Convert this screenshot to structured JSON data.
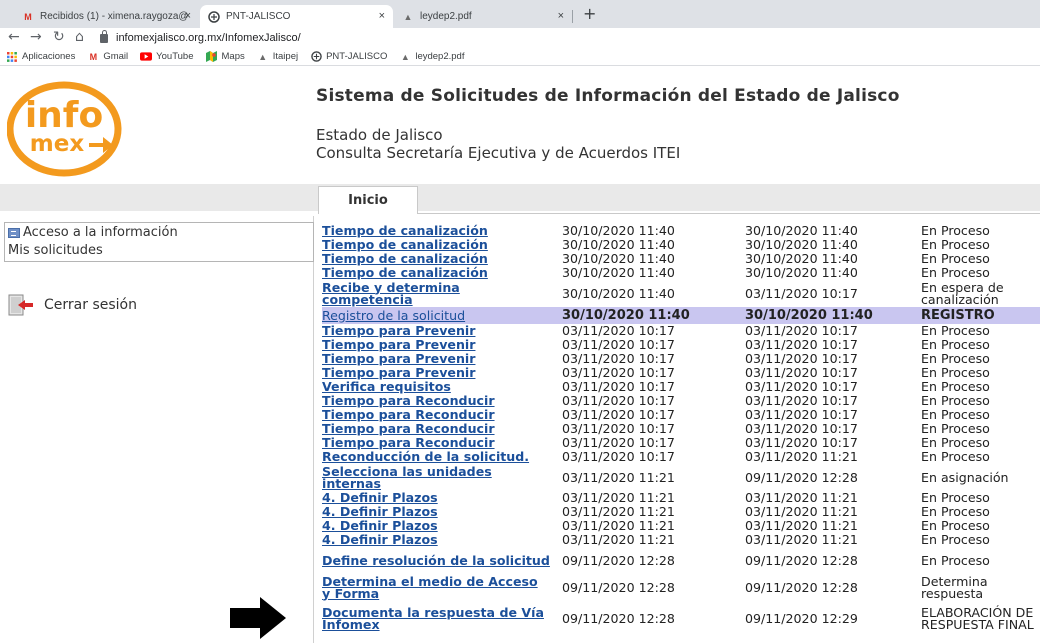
{
  "browser": {
    "tabs": [
      {
        "label": "Recibidos (1) - ximena.raygoza@",
        "icon": "gmail-icon",
        "active": false
      },
      {
        "label": "PNT-JALISCO",
        "icon": "pnt-icon",
        "active": true
      },
      {
        "label": "leydep2.pdf",
        "icon": "itaipej-icon",
        "active": false
      }
    ],
    "new_tab": "+",
    "close_glyph": "×",
    "url": "infomexjalisco.org.mx/InfomexJalisco/",
    "bookmarks": [
      {
        "label": "Aplicaciones",
        "icon": "apps-grid-icon"
      },
      {
        "label": "Gmail",
        "icon": "gmail-icon"
      },
      {
        "label": "YouTube",
        "icon": "youtube-icon"
      },
      {
        "label": "Maps",
        "icon": "maps-icon"
      },
      {
        "label": "Itaipej",
        "icon": "itaipej-icon"
      },
      {
        "label": "PNT-JALISCO",
        "icon": "pnt-icon"
      },
      {
        "label": "leydep2.pdf",
        "icon": "itaipej-icon"
      }
    ]
  },
  "header": {
    "logo_top": "info",
    "logo_bottom": "mex",
    "title": "Sistema de Solicitudes de Información del Estado de Jalisco",
    "state": "Estado de Jalisco",
    "office": "Consulta Secretaría Ejecutiva y de Acuerdos ITEI"
  },
  "nav": {
    "tab_inicio": "Inicio"
  },
  "sidebar": {
    "menu": [
      "Acceso a la información",
      "Mis solicitudes"
    ],
    "logout": "Cerrar sesión"
  },
  "colors": {
    "link": "#1b4f9a",
    "highlight_row": "#c9c6f0",
    "logo_orange": "#f39a1e"
  },
  "table": {
    "rows": [
      {
        "task": "Tiempo de canalización",
        "start": "30/10/2020 11:40",
        "end": "30/10/2020 11:40",
        "status": "En Proceso"
      },
      {
        "task": "Tiempo de canalización",
        "start": "30/10/2020 11:40",
        "end": "30/10/2020 11:40",
        "status": "En Proceso"
      },
      {
        "task": "Tiempo de canalización",
        "start": "30/10/2020 11:40",
        "end": "30/10/2020 11:40",
        "status": "En Proceso"
      },
      {
        "task": "Tiempo de canalización",
        "start": "30/10/2020 11:40",
        "end": "30/10/2020 11:40",
        "status": "En Proceso"
      },
      {
        "task": "Recibe y determina competencia",
        "start": "30/10/2020 11:40",
        "end": "03/11/2020 10:17",
        "status": "En espera de canalización"
      },
      {
        "task": "Registro de la solicitud",
        "start": "30/10/2020 11:40",
        "end": "30/10/2020 11:40",
        "status": "REGISTRO"
      },
      {
        "task": "Tiempo para Prevenir",
        "start": "03/11/2020 10:17",
        "end": "03/11/2020 10:17",
        "status": "En Proceso"
      },
      {
        "task": "Tiempo para Prevenir",
        "start": "03/11/2020 10:17",
        "end": "03/11/2020 10:17",
        "status": "En Proceso"
      },
      {
        "task": "Tiempo para Prevenir",
        "start": "03/11/2020 10:17",
        "end": "03/11/2020 10:17",
        "status": "En Proceso"
      },
      {
        "task": "Tiempo para Prevenir",
        "start": "03/11/2020 10:17",
        "end": "03/11/2020 10:17",
        "status": "En Proceso"
      },
      {
        "task": "Verifica requisitos",
        "start": "03/11/2020 10:17",
        "end": "03/11/2020 10:17",
        "status": "En Proceso"
      },
      {
        "task": "Tiempo para Reconducir",
        "start": "03/11/2020 10:17",
        "end": "03/11/2020 10:17",
        "status": "En Proceso"
      },
      {
        "task": "Tiempo para Reconducir",
        "start": "03/11/2020 10:17",
        "end": "03/11/2020 10:17",
        "status": "En Proceso"
      },
      {
        "task": "Tiempo para Reconducir",
        "start": "03/11/2020 10:17",
        "end": "03/11/2020 10:17",
        "status": "En Proceso"
      },
      {
        "task": "Tiempo para Reconducir",
        "start": "03/11/2020 10:17",
        "end": "03/11/2020 10:17",
        "status": "En Proceso"
      },
      {
        "task": "Reconducción de la solicitud.",
        "start": "03/11/2020 10:17",
        "end": "03/11/2020 11:21",
        "status": "En Proceso"
      },
      {
        "task": "Selecciona las unidades internas",
        "start": "03/11/2020 11:21",
        "end": "09/11/2020 12:28",
        "status": "En asignación"
      },
      {
        "task": "4. Definir Plazos",
        "start": "03/11/2020 11:21",
        "end": "03/11/2020 11:21",
        "status": "En Proceso"
      },
      {
        "task": "4. Definir Plazos",
        "start": "03/11/2020 11:21",
        "end": "03/11/2020 11:21",
        "status": "En Proceso"
      },
      {
        "task": "4. Definir Plazos",
        "start": "03/11/2020 11:21",
        "end": "03/11/2020 11:21",
        "status": "En Proceso"
      },
      {
        "task": "4. Definir Plazos",
        "start": "03/11/2020 11:21",
        "end": "03/11/2020 11:21",
        "status": "En Proceso"
      },
      {
        "task": "Define resolución de la solicitud",
        "start": "09/11/2020 12:28",
        "end": "09/11/2020 12:28",
        "status": "En Proceso"
      },
      {
        "task": "Determina el medio de Acceso y Forma",
        "start": "09/11/2020 12:28",
        "end": "09/11/2020 12:28",
        "status": "Determina respuesta"
      },
      {
        "task": "Documenta la respuesta de Vía Infomex",
        "start": "09/11/2020 12:28",
        "end": "09/11/2020 12:29",
        "status": "ELABORACIÓN DE RESPUESTA FINAL"
      }
    ]
  }
}
